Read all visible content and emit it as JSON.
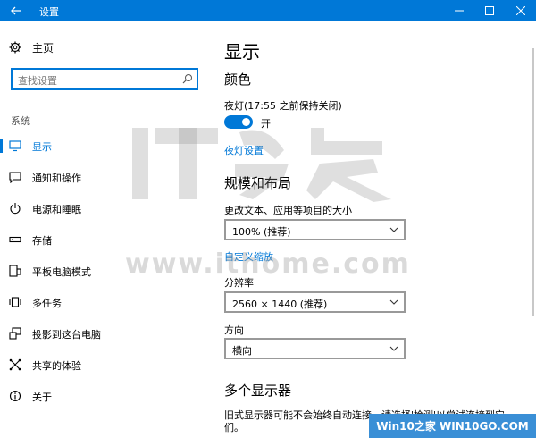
{
  "titlebar": {
    "title": "设置",
    "back_icon": "back-arrow-icon",
    "minimize_icon": "minimize-icon",
    "maximize_icon": "maximize-icon",
    "close_icon": "close-icon",
    "bg_color": "#0078d7"
  },
  "sidebar": {
    "home_label": "主页",
    "search_placeholder": "查找设置",
    "group_title": "系统",
    "items": [
      {
        "label": "显示",
        "icon": "monitor-icon",
        "active": true
      },
      {
        "label": "通知和操作",
        "icon": "message-icon",
        "active": false
      },
      {
        "label": "电源和睡眠",
        "icon": "power-icon",
        "active": false
      },
      {
        "label": "存储",
        "icon": "storage-icon",
        "active": false
      },
      {
        "label": "平板电脑模式",
        "icon": "tablet-icon",
        "active": false
      },
      {
        "label": "多任务",
        "icon": "multitask-icon",
        "active": false
      },
      {
        "label": "投影到这台电脑",
        "icon": "project-icon",
        "active": false
      },
      {
        "label": "共享的体验",
        "icon": "share-icon",
        "active": false
      },
      {
        "label": "关于",
        "icon": "info-icon",
        "active": false
      }
    ]
  },
  "main": {
    "title": "显示",
    "color_heading": "颜色",
    "night_light_label": "夜灯(17:55 之前保持关闭)",
    "night_light_state": "开",
    "night_light_on": true,
    "night_light_settings_link": "夜灯设置",
    "scale_heading": "规模和布局",
    "scale_label": "更改文本、应用等项目的大小",
    "scale_value": "100% (推荐)",
    "custom_scale_link": "自定义缩放",
    "resolution_label": "分辨率",
    "resolution_value": "2560 × 1440 (推荐)",
    "orientation_label": "方向",
    "orientation_value": "横向",
    "multi_display_heading": "多个显示器",
    "multi_display_text": "旧式显示器可能不会始终自动连接。请选择'检测'以尝试连接到它们。"
  },
  "watermark": {
    "url": "www.ithome.com",
    "badge": "Win10之家 WIN10GO.COM"
  },
  "colors": {
    "accent": "#0078d7"
  }
}
